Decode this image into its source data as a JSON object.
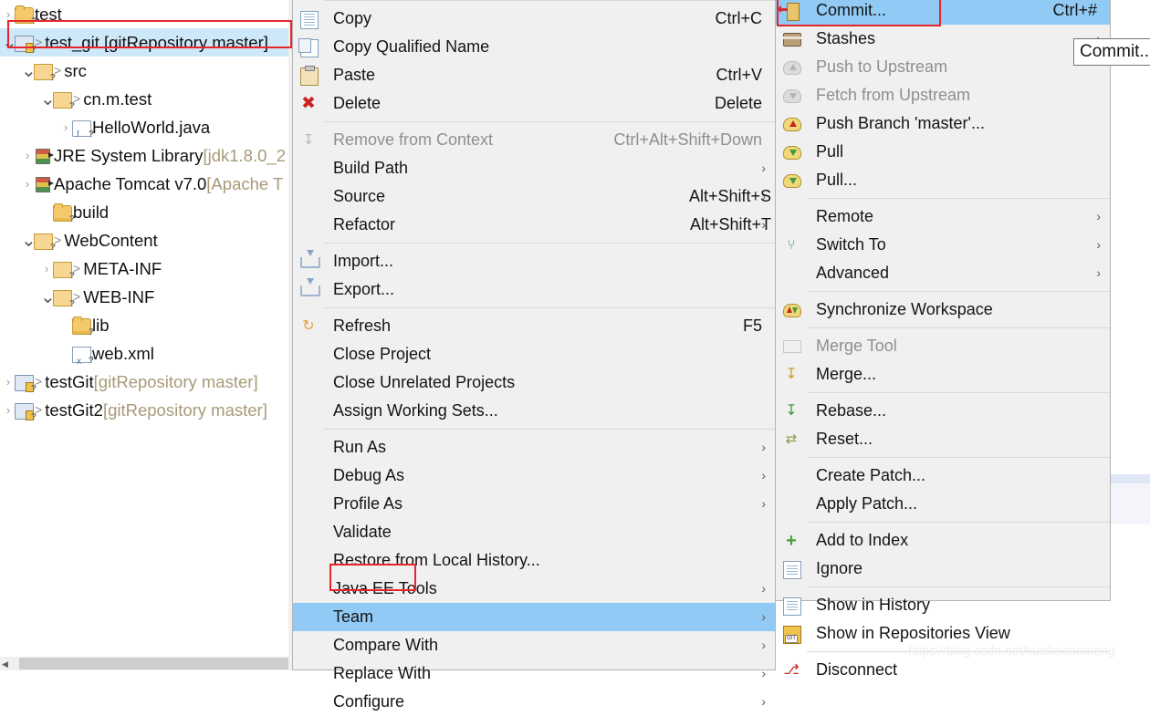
{
  "explorer": {
    "name": "project-explorer",
    "rows": [
      {
        "label": "test",
        "indent": 0,
        "arrow": "collapsed",
        "icon": "folder-open-icon",
        "dim": "",
        "caret": false,
        "selected": false
      },
      {
        "label": "test_git [gitRepository master]",
        "indent": 0,
        "arrow": "expanded",
        "icon": "java-project-icon",
        "dim": "",
        "caret": true,
        "selected": true
      },
      {
        "label": "src",
        "indent": 1,
        "arrow": "expanded",
        "icon": "source-folder-icon",
        "dim": "",
        "caret": true,
        "selected": false
      },
      {
        "label": "cn.m.test",
        "indent": 2,
        "arrow": "expanded",
        "icon": "package-icon",
        "dim": "",
        "caret": true,
        "selected": false
      },
      {
        "label": "HelloWorld.java",
        "indent": 3,
        "arrow": "collapsed",
        "icon": "java-file-icon",
        "dim": "",
        "caret": false,
        "selected": false
      },
      {
        "label": "JRE System Library ",
        "indent": 1,
        "arrow": "collapsed",
        "icon": "library-icon",
        "dim": "[jdk1.8.0_2",
        "caret": false,
        "selected": false
      },
      {
        "label": "Apache Tomcat v7.0 ",
        "indent": 1,
        "arrow": "collapsed",
        "icon": "library-icon",
        "dim": "[Apache T",
        "caret": false,
        "selected": false
      },
      {
        "label": "build",
        "indent": 2,
        "arrow": "none",
        "icon": "folder-open-icon",
        "dim": "",
        "caret": false,
        "selected": false
      },
      {
        "label": "WebContent",
        "indent": 1,
        "arrow": "expanded",
        "icon": "folder-icon",
        "dim": "",
        "caret": true,
        "selected": false
      },
      {
        "label": "META-INF",
        "indent": 2,
        "arrow": "collapsed",
        "icon": "folder-icon",
        "dim": "",
        "caret": true,
        "selected": false
      },
      {
        "label": "WEB-INF",
        "indent": 2,
        "arrow": "expanded",
        "icon": "folder-icon",
        "dim": "",
        "caret": true,
        "selected": false
      },
      {
        "label": "lib",
        "indent": 3,
        "arrow": "none",
        "icon": "folder-open-icon",
        "dim": "",
        "caret": false,
        "selected": false
      },
      {
        "label": "web.xml",
        "indent": 3,
        "arrow": "none",
        "icon": "xml-file-icon",
        "dim": "",
        "caret": false,
        "selected": false
      },
      {
        "label": "testGit ",
        "indent": 0,
        "arrow": "collapsed",
        "icon": "java-project-icon",
        "dim": "[gitRepository master]",
        "caret": true,
        "selected": false
      },
      {
        "label": "testGit2 ",
        "indent": 0,
        "arrow": "collapsed",
        "icon": "java-project-icon",
        "dim": "[gitRepository master]",
        "caret": true,
        "selected": false
      }
    ]
  },
  "context_menu": {
    "name": "project-context-menu",
    "items": [
      {
        "type": "sep",
        "full": true
      },
      {
        "type": "item",
        "label": "Copy",
        "accel": "Ctrl+C",
        "icon": "copy-icon",
        "arrow": false,
        "disabled": false
      },
      {
        "type": "item",
        "label": "Copy Qualified Name",
        "accel": "",
        "icon": "copy-qualified-icon",
        "arrow": false,
        "disabled": false
      },
      {
        "type": "item",
        "label": "Paste",
        "accel": "Ctrl+V",
        "icon": "paste-icon",
        "arrow": false,
        "disabled": false
      },
      {
        "type": "item",
        "label": "Delete",
        "accel": "Delete",
        "icon": "delete-icon",
        "arrow": false,
        "disabled": false
      },
      {
        "type": "sep"
      },
      {
        "type": "item",
        "label": "Remove from Context",
        "accel": "Ctrl+Alt+Shift+Down",
        "icon": "remove-from-context-icon",
        "arrow": false,
        "disabled": true
      },
      {
        "type": "item",
        "label": "Build Path",
        "accel": "",
        "icon": "",
        "arrow": true,
        "disabled": false
      },
      {
        "type": "item",
        "label": "Source",
        "accel": "Alt+Shift+S",
        "icon": "",
        "arrow": true,
        "disabled": false
      },
      {
        "type": "item",
        "label": "Refactor",
        "accel": "Alt+Shift+T",
        "icon": "",
        "arrow": true,
        "disabled": false
      },
      {
        "type": "sep"
      },
      {
        "type": "item",
        "label": "Import...",
        "accel": "",
        "icon": "import-icon",
        "arrow": false,
        "disabled": false
      },
      {
        "type": "item",
        "label": "Export...",
        "accel": "",
        "icon": "export-icon",
        "arrow": false,
        "disabled": false
      },
      {
        "type": "sep"
      },
      {
        "type": "item",
        "label": "Refresh",
        "accel": "F5",
        "icon": "refresh-icon",
        "arrow": false,
        "disabled": false
      },
      {
        "type": "item",
        "label": "Close Project",
        "accel": "",
        "icon": "",
        "arrow": false,
        "disabled": false
      },
      {
        "type": "item",
        "label": "Close Unrelated Projects",
        "accel": "",
        "icon": "",
        "arrow": false,
        "disabled": false
      },
      {
        "type": "item",
        "label": "Assign Working Sets...",
        "accel": "",
        "icon": "",
        "arrow": false,
        "disabled": false
      },
      {
        "type": "sep"
      },
      {
        "type": "item",
        "label": "Run As",
        "accel": "",
        "icon": "",
        "arrow": true,
        "disabled": false
      },
      {
        "type": "item",
        "label": "Debug As",
        "accel": "",
        "icon": "",
        "arrow": true,
        "disabled": false
      },
      {
        "type": "item",
        "label": "Profile As",
        "accel": "",
        "icon": "",
        "arrow": true,
        "disabled": false
      },
      {
        "type": "item",
        "label": "Validate",
        "accel": "",
        "icon": "",
        "arrow": false,
        "disabled": false
      },
      {
        "type": "item",
        "label": "Restore from Local History...",
        "accel": "",
        "icon": "",
        "arrow": false,
        "disabled": false
      },
      {
        "type": "item",
        "label": "Java EE Tools",
        "accel": "",
        "icon": "",
        "arrow": true,
        "disabled": false
      },
      {
        "type": "item",
        "label": "Team",
        "accel": "",
        "icon": "",
        "arrow": true,
        "disabled": false,
        "highlighted": true
      },
      {
        "type": "item",
        "label": "Compare With",
        "accel": "",
        "icon": "",
        "arrow": true,
        "disabled": false
      },
      {
        "type": "item",
        "label": "Replace With",
        "accel": "",
        "icon": "",
        "arrow": true,
        "disabled": false
      },
      {
        "type": "item",
        "label": "Configure",
        "accel": "",
        "icon": "",
        "arrow": true,
        "disabled": false
      }
    ]
  },
  "team_menu": {
    "name": "team-submenu",
    "items": [
      {
        "type": "item",
        "label": "Commit...",
        "accel": "Ctrl+#",
        "icon": "commit-icon",
        "arrow": false,
        "disabled": false,
        "highlighted": true
      },
      {
        "type": "item",
        "label": "Stashes",
        "accel": "",
        "icon": "stashes-icon",
        "arrow": true,
        "disabled": false
      },
      {
        "type": "item",
        "label": "Push to Upstream",
        "accel": "",
        "icon": "push-upstream-icon",
        "arrow": false,
        "disabled": true
      },
      {
        "type": "item",
        "label": "Fetch from Upstream",
        "accel": "",
        "icon": "fetch-upstream-icon",
        "arrow": false,
        "disabled": true
      },
      {
        "type": "item",
        "label": "Push Branch 'master'...",
        "accel": "",
        "icon": "push-branch-icon",
        "arrow": false,
        "disabled": false
      },
      {
        "type": "item",
        "label": "Pull",
        "accel": "",
        "icon": "pull-icon",
        "arrow": false,
        "disabled": false
      },
      {
        "type": "item",
        "label": "Pull...",
        "accel": "",
        "icon": "pull-dialog-icon",
        "arrow": false,
        "disabled": false
      },
      {
        "type": "sep"
      },
      {
        "type": "item",
        "label": "Remote",
        "accel": "",
        "icon": "",
        "arrow": true,
        "disabled": false
      },
      {
        "type": "item",
        "label": "Switch To",
        "accel": "",
        "icon": "switch-to-icon",
        "arrow": true,
        "disabled": false
      },
      {
        "type": "item",
        "label": "Advanced",
        "accel": "",
        "icon": "",
        "arrow": true,
        "disabled": false
      },
      {
        "type": "sep"
      },
      {
        "type": "item",
        "label": "Synchronize Workspace",
        "accel": "",
        "icon": "synchronize-icon",
        "arrow": false,
        "disabled": false
      },
      {
        "type": "sep"
      },
      {
        "type": "item",
        "label": "Merge Tool",
        "accel": "",
        "icon": "merge-tool-icon",
        "arrow": false,
        "disabled": true
      },
      {
        "type": "item",
        "label": "Merge...",
        "accel": "",
        "icon": "merge-icon",
        "arrow": false,
        "disabled": false
      },
      {
        "type": "sep"
      },
      {
        "type": "item",
        "label": "Rebase...",
        "accel": "",
        "icon": "rebase-icon",
        "arrow": false,
        "disabled": false
      },
      {
        "type": "item",
        "label": "Reset...",
        "accel": "",
        "icon": "reset-icon",
        "arrow": false,
        "disabled": false
      },
      {
        "type": "sep"
      },
      {
        "type": "item",
        "label": "Create Patch...",
        "accel": "",
        "icon": "",
        "arrow": false,
        "disabled": false
      },
      {
        "type": "item",
        "label": "Apply Patch...",
        "accel": "",
        "icon": "",
        "arrow": false,
        "disabled": false
      },
      {
        "type": "sep"
      },
      {
        "type": "item",
        "label": "Add to Index",
        "accel": "",
        "icon": "add-to-index-icon",
        "arrow": false,
        "disabled": false
      },
      {
        "type": "item",
        "label": "Ignore",
        "accel": "",
        "icon": "ignore-icon",
        "arrow": false,
        "disabled": false
      },
      {
        "type": "sep"
      },
      {
        "type": "item",
        "label": "Show in History",
        "accel": "",
        "icon": "history-icon",
        "arrow": false,
        "disabled": false
      },
      {
        "type": "item",
        "label": "Show in Repositories View",
        "accel": "",
        "icon": "repositories-icon",
        "arrow": false,
        "disabled": false
      },
      {
        "type": "sep"
      },
      {
        "type": "item",
        "label": "Disconnect",
        "accel": "",
        "icon": "disconnect-icon",
        "arrow": false,
        "disabled": false
      }
    ]
  },
  "tooltip": {
    "text": "Commit..."
  },
  "watermark": {
    "text": "https://blog.csdn.net/kuailexiaomeng"
  },
  "annotations": {
    "tree_highlight_label": "test_git [gitRepository master]",
    "team_highlight_label": "Team",
    "commit_highlight_label": "Commit..."
  },
  "colors": {
    "menu_bg": "#f0f0f0",
    "menu_border": "#b4b4b4",
    "highlight": "#91caf4",
    "tree_selection": "#cde8f8",
    "annotation_red": "#e8252a",
    "disabled_text": "#8f8f8f",
    "dim_text": "#a89a78"
  }
}
